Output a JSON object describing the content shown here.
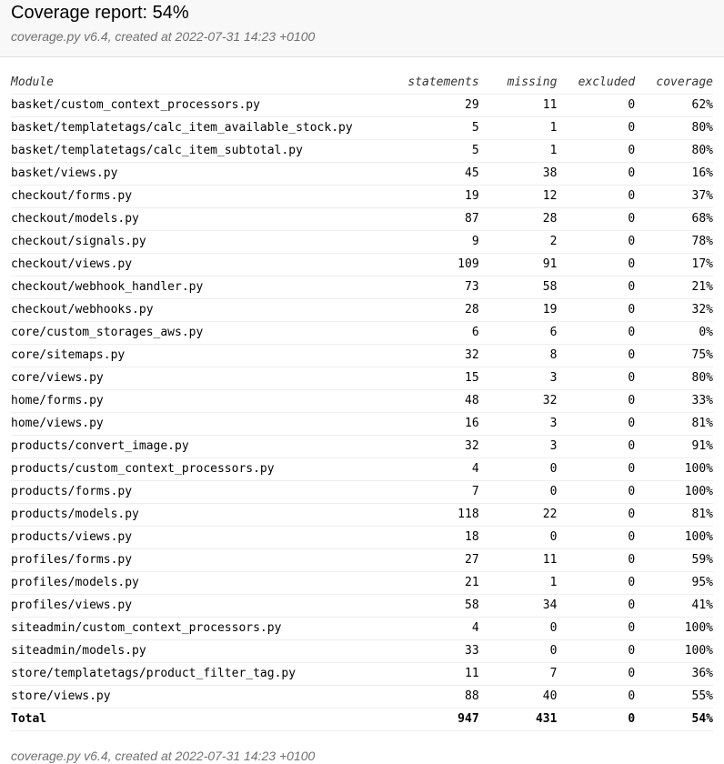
{
  "header": {
    "title": "Coverage report: 54%",
    "meta": "coverage.py v6.4, created at 2022-07-31 14:23 +0100"
  },
  "table": {
    "columns": [
      "Module",
      "statements",
      "missing",
      "excluded",
      "coverage"
    ],
    "rows": [
      [
        "basket/custom_context_processors.py",
        "29",
        "11",
        "0",
        "62%"
      ],
      [
        "basket/templatetags/calc_item_available_stock.py",
        "5",
        "1",
        "0",
        "80%"
      ],
      [
        "basket/templatetags/calc_item_subtotal.py",
        "5",
        "1",
        "0",
        "80%"
      ],
      [
        "basket/views.py",
        "45",
        "38",
        "0",
        "16%"
      ],
      [
        "checkout/forms.py",
        "19",
        "12",
        "0",
        "37%"
      ],
      [
        "checkout/models.py",
        "87",
        "28",
        "0",
        "68%"
      ],
      [
        "checkout/signals.py",
        "9",
        "2",
        "0",
        "78%"
      ],
      [
        "checkout/views.py",
        "109",
        "91",
        "0",
        "17%"
      ],
      [
        "checkout/webhook_handler.py",
        "73",
        "58",
        "0",
        "21%"
      ],
      [
        "checkout/webhooks.py",
        "28",
        "19",
        "0",
        "32%"
      ],
      [
        "core/custom_storages_aws.py",
        "6",
        "6",
        "0",
        "0%"
      ],
      [
        "core/sitemaps.py",
        "32",
        "8",
        "0",
        "75%"
      ],
      [
        "core/views.py",
        "15",
        "3",
        "0",
        "80%"
      ],
      [
        "home/forms.py",
        "48",
        "32",
        "0",
        "33%"
      ],
      [
        "home/views.py",
        "16",
        "3",
        "0",
        "81%"
      ],
      [
        "products/convert_image.py",
        "32",
        "3",
        "0",
        "91%"
      ],
      [
        "products/custom_context_processors.py",
        "4",
        "0",
        "0",
        "100%"
      ],
      [
        "products/forms.py",
        "7",
        "0",
        "0",
        "100%"
      ],
      [
        "products/models.py",
        "118",
        "22",
        "0",
        "81%"
      ],
      [
        "products/views.py",
        "18",
        "0",
        "0",
        "100%"
      ],
      [
        "profiles/forms.py",
        "27",
        "11",
        "0",
        "59%"
      ],
      [
        "profiles/models.py",
        "21",
        "1",
        "0",
        "95%"
      ],
      [
        "profiles/views.py",
        "58",
        "34",
        "0",
        "41%"
      ],
      [
        "siteadmin/custom_context_processors.py",
        "4",
        "0",
        "0",
        "100%"
      ],
      [
        "siteadmin/models.py",
        "33",
        "0",
        "0",
        "100%"
      ],
      [
        "store/templatetags/product_filter_tag.py",
        "11",
        "7",
        "0",
        "36%"
      ],
      [
        "store/views.py",
        "88",
        "40",
        "0",
        "55%"
      ]
    ],
    "total": [
      "Total",
      "947",
      "431",
      "0",
      "54%"
    ]
  },
  "footer": {
    "meta": "coverage.py v6.4, created at 2022-07-31 14:23 +0100"
  }
}
